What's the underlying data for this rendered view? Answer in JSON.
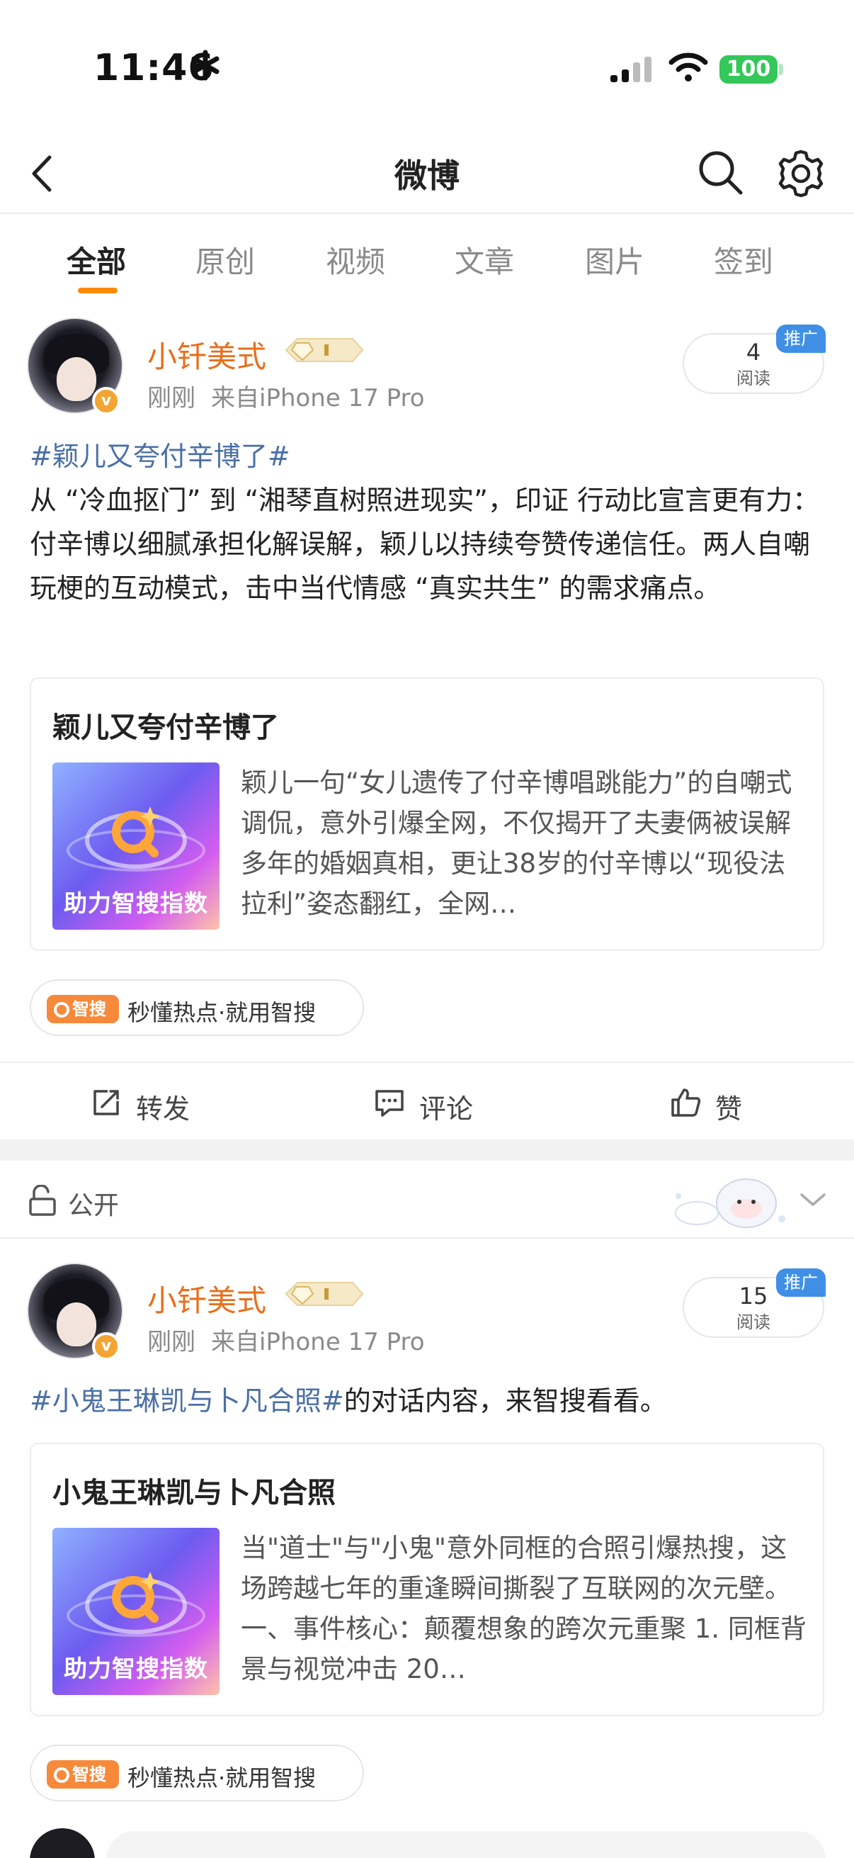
{
  "status_bar": {
    "time": "11:46",
    "battery": "100"
  },
  "nav": {
    "title": "微博"
  },
  "tabs": [
    "全部",
    "原创",
    "视频",
    "文章",
    "图片",
    "签到"
  ],
  "posts": [
    {
      "author": "小钎美式",
      "time": "刚刚",
      "source": "来自iPhone 17 Pro",
      "read_count": "4",
      "read_label": "阅读",
      "promo_tag": "推广",
      "hashtag": "#颖儿又夸付辛博了#",
      "text": "从 “冷血抠门” 到 “湘琴直树照进现实”，印证 行动比宣言更有力：付辛博以细腻承担化解误解，颖儿以持续夸赞传递信任。两人自嘲玩梗的互动模式，击中当代情感 “真实共生” 的需求痛点。",
      "card": {
        "title": "颖儿又夸付辛博了",
        "thumb_text": "助力智搜指数",
        "desc": "颖儿一句“女儿遗传了付辛博唱跳能力”的自嘲式调侃，意外引爆全网，不仅揭开了夫妻俩被误解多年的婚姻真相，更让38岁的付辛博以“现役法拉利”姿态翻红，全网…"
      },
      "smart_chip": {
        "logo": "智搜",
        "label": "秒懂热点·就用智搜"
      },
      "actions": {
        "repost": "转发",
        "comment": "评论",
        "like": "赞"
      }
    },
    {
      "author": "小钎美式",
      "time": "刚刚",
      "source": "来自iPhone 17 Pro",
      "read_count": "15",
      "read_label": "阅读",
      "promo_tag": "推广",
      "hashtag": "#小鬼王琳凯与卜凡合照#",
      "text": "的对话内容，来智搜看看。",
      "card": {
        "title": "小鬼王琳凯与卜凡合照",
        "thumb_text": "助力智搜指数",
        "desc": "当\"道士\"与\"小鬼\"意外同框的合照引爆热搜，这场跨越七年的重逢瞬间撕裂了互联网的次元壁。 一、事件核心：颠覆想象的跨次元重聚  1. 同框背景与视觉冲击      20…"
      },
      "smart_chip": {
        "logo": "智搜",
        "label": "秒懂热点·就用智搜"
      }
    }
  ],
  "visibility": {
    "label": "公开"
  },
  "colors": {
    "accent": "#ff8a00",
    "author": "#e86e1a",
    "hashtag": "#4a6fa5",
    "promo": "#3f8fe6",
    "battery": "#34c759"
  }
}
